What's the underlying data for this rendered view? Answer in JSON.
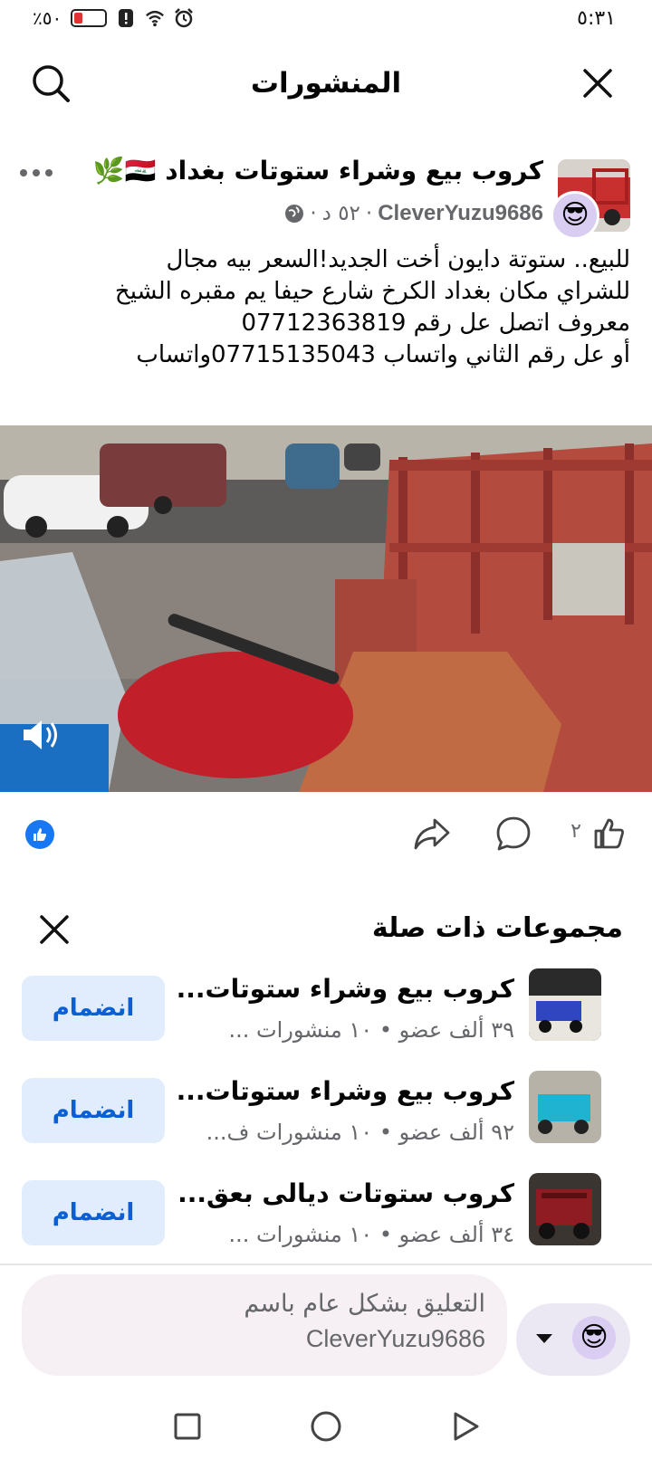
{
  "status_bar": {
    "time": "٥:٣١",
    "battery": "٪٥٠"
  },
  "header": {
    "title": "المنشورات"
  },
  "post": {
    "group_name": "كروب بيع وشراء ستوتات بغداد 🇮🇶🌿",
    "author": "CleverYuzu9686",
    "time": "٥٢ د",
    "text_lines": [
      "للبيع.. ستوتة دايون أخت الجديد!السعر بيه مجال",
      "للشراي  مكان بغداد الكرخ شارع حيفا يم مقبره الشيخ",
      "معروف اتصل عل رقم 07712363819",
      "أو عل رقم الثاني واتساب 07715135043واتساب"
    ],
    "like_count": "٢"
  },
  "related": {
    "title": "مجموعات ذات صلة",
    "join_label": "انضمام",
    "groups": [
      {
        "name": "كروب بيع وشراء ستوتات...",
        "meta": "٣٩ ألف عضو • ١٠ منشورات ..."
      },
      {
        "name": "كروب بيع وشراء ستوتات...",
        "meta": "٩٢ ألف عضو • ١٠ منشورات ف..."
      },
      {
        "name": "كروب ستوتات ديالى بعق...",
        "meta": "٣٤ ألف عضو • ١٠ منشورات ..."
      }
    ]
  },
  "composer": {
    "placeholder_line1": "التعليق بشكل عام باسم",
    "placeholder_line2": "CleverYuzu9686"
  },
  "colors": {
    "accent": "#1877f2",
    "join_bg": "#e1edfc",
    "join_text": "#0a5fd4",
    "secondary_text": "#65676b"
  },
  "icons": {
    "close": "close-icon",
    "search": "search-icon",
    "more": "more-icon",
    "globe": "globe-icon",
    "like": "like-icon",
    "comment": "comment-icon",
    "share": "share-icon",
    "mute": "speaker-icon"
  }
}
